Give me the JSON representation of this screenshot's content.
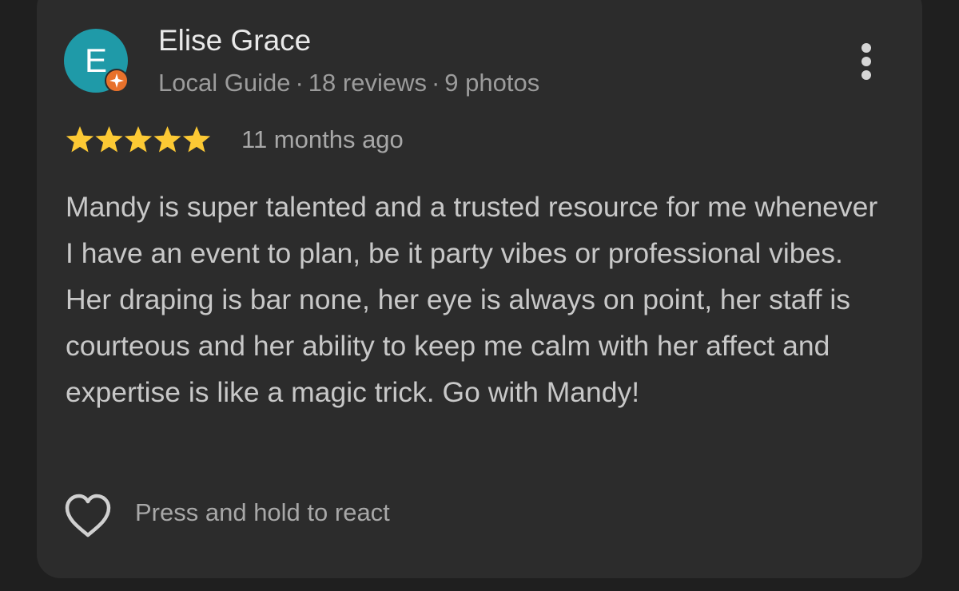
{
  "review": {
    "author": {
      "initial": "E",
      "name": "Elise Grace",
      "badge": "Local Guide",
      "reviews": "18 reviews",
      "photos": "9 photos",
      "separator": "·",
      "avatar_color": "#1f9aa8",
      "badge_icon": "local-guide-badge-icon"
    },
    "rating": 5,
    "rating_max": 5,
    "star_color": "#fcc934",
    "date": "11 months ago",
    "text": "Mandy is super talented and a trusted resource for me whenever I have an event to plan, be it party vibes or professional vibes. Her draping is bar none, her eye is always on point, her staff is courteous and her ability to keep me calm with her affect and expertise is like a magic trick. Go with Mandy!",
    "react": {
      "icon": "heart-outline-icon",
      "label": "Press and hold to react"
    },
    "menu_icon": "more-vert-icon"
  }
}
